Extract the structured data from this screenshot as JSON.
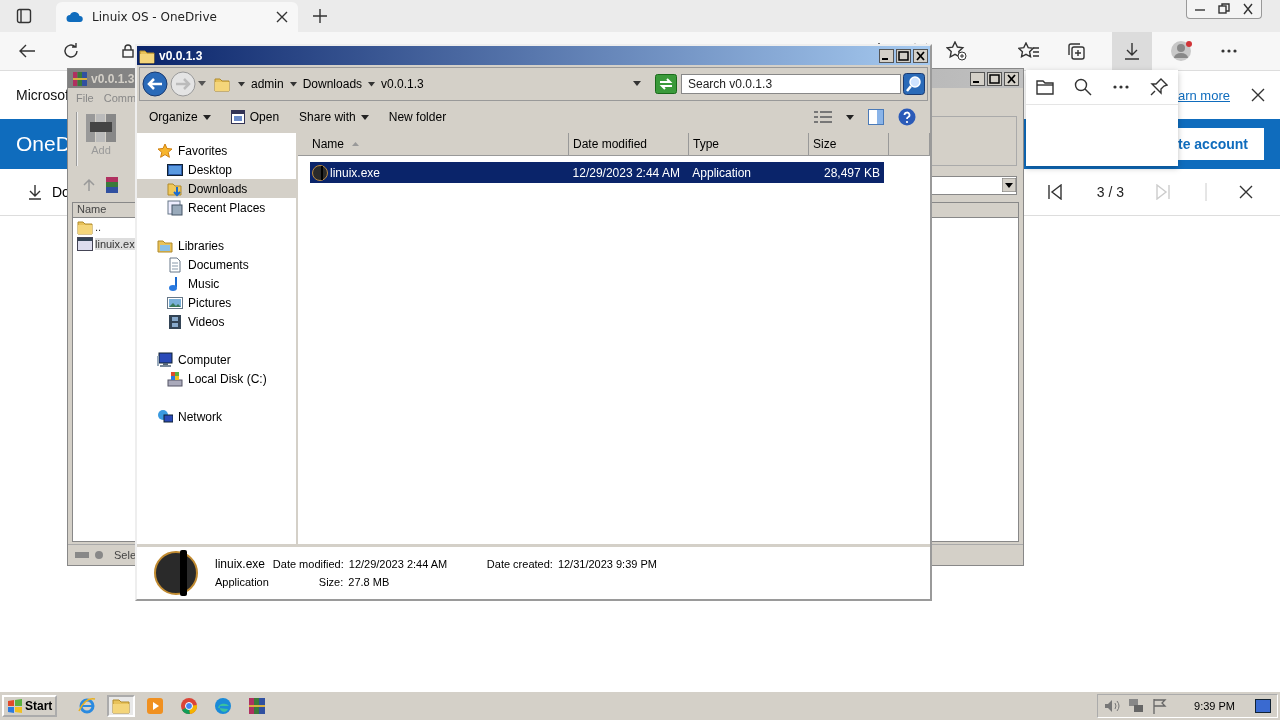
{
  "browser": {
    "tab": {
      "title": "Linuix OS - OneDrive"
    },
    "page": {
      "brand": "Microsof",
      "learn_more": "arn more",
      "app_name": "OneD",
      "create_account": "te account",
      "toolbar_item": "Do",
      "pager": "3 / 3"
    }
  },
  "archiver": {
    "title": "v0.0.1.3",
    "menu": [
      "File",
      "Comm"
    ],
    "tool": "Add",
    "list_header": "Name",
    "files": [
      {
        "kind": "parent",
        "name": "..",
        "selected": false
      },
      {
        "kind": "exe",
        "name": "linuix.ex",
        "selected": true
      }
    ],
    "status": "Sele"
  },
  "explorer": {
    "title": "v0.0.1.3",
    "breadcrumb": [
      "admin",
      "Downloads",
      "v0.0.1.3"
    ],
    "search": {
      "placeholder": "Search v0.0.1.3"
    },
    "commands": [
      {
        "kind": "menu",
        "label": "Organize"
      },
      {
        "kind": "open",
        "label": "Open"
      },
      {
        "kind": "menu",
        "label": "Share with"
      },
      {
        "kind": "plain",
        "label": "New folder"
      }
    ],
    "nav": [
      {
        "kind": "star",
        "label": "Favorites",
        "children": [
          {
            "kind": "desktop",
            "label": "Desktop",
            "selected": false
          },
          {
            "kind": "downloads",
            "label": "Downloads",
            "selected": true
          },
          {
            "kind": "recent",
            "label": "Recent Places",
            "selected": false
          }
        ]
      },
      {
        "kind": "libraries",
        "label": "Libraries",
        "children": [
          {
            "kind": "document",
            "label": "Documents",
            "selected": false
          },
          {
            "kind": "music",
            "label": "Music",
            "selected": false
          },
          {
            "kind": "pictures",
            "label": "Pictures",
            "selected": false
          },
          {
            "kind": "videos",
            "label": "Videos",
            "selected": false
          }
        ]
      },
      {
        "kind": "computer",
        "label": "Computer",
        "children": [
          {
            "kind": "disk",
            "label": "Local Disk (C:)",
            "selected": false
          }
        ]
      },
      {
        "kind": "network",
        "label": "Network"
      }
    ],
    "columns": [
      {
        "label": "Name",
        "sorted": true
      },
      {
        "label": "Date modified",
        "sorted": false
      },
      {
        "label": "Type",
        "sorted": false
      },
      {
        "label": "Size",
        "sorted": false
      }
    ],
    "rows": [
      {
        "name": "linuix.exe",
        "date": "12/29/2023 2:44 AM",
        "type": "Application",
        "size": "28,497 KB",
        "selected": true
      }
    ],
    "details": {
      "name": "linuix.exe",
      "type": "Application",
      "fields": [
        {
          "label": "Date modified:",
          "value": "12/29/2023 2:44 AM"
        },
        {
          "label": "Size:",
          "value": "27.8 MB"
        },
        {
          "label": "Date created:",
          "value": "12/31/2023 9:39 PM"
        }
      ]
    }
  },
  "taskbar": {
    "start": "Start",
    "apps": [
      {
        "kind": "ie",
        "active": false
      },
      {
        "kind": "folder",
        "active": true
      },
      {
        "kind": "media",
        "active": false
      },
      {
        "kind": "chrome",
        "active": false
      },
      {
        "kind": "edge",
        "active": false
      },
      {
        "kind": "rar",
        "active": false
      }
    ],
    "clock": "9:39 PM"
  }
}
